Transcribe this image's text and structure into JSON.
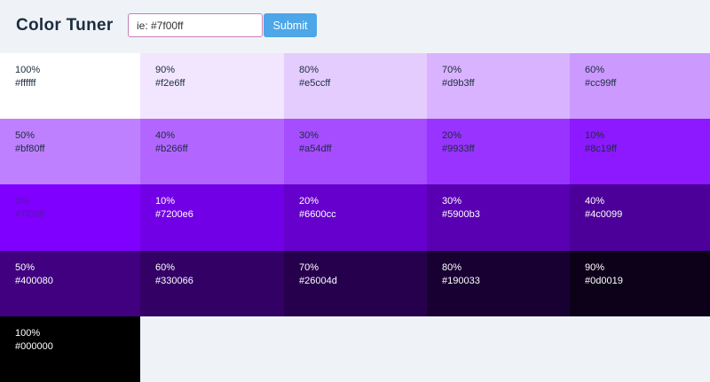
{
  "header": {
    "title": "Color Tuner",
    "input_placeholder": "ie: #7f00ff",
    "input_value": "",
    "submit_label": "Submit"
  },
  "swatches": [
    {
      "percent": "100%",
      "hex": "#ffffff",
      "bg": "#ffffff",
      "fg": "#1b2c3f"
    },
    {
      "percent": "90%",
      "hex": "#f2e6ff",
      "bg": "#f2e6ff",
      "fg": "#1b2c3f"
    },
    {
      "percent": "80%",
      "hex": "#e5ccff",
      "bg": "#e5ccff",
      "fg": "#1b2c3f"
    },
    {
      "percent": "70%",
      "hex": "#d9b3ff",
      "bg": "#d9b3ff",
      "fg": "#1b2c3f"
    },
    {
      "percent": "60%",
      "hex": "#cc99ff",
      "bg": "#cc99ff",
      "fg": "#1b2c3f"
    },
    {
      "percent": "50%",
      "hex": "#bf80ff",
      "bg": "#bf80ff",
      "fg": "#1b2c3f"
    },
    {
      "percent": "40%",
      "hex": "#b266ff",
      "bg": "#b266ff",
      "fg": "#1b2c3f"
    },
    {
      "percent": "30%",
      "hex": "#a54dff",
      "bg": "#a54dff",
      "fg": "#1b2c3f"
    },
    {
      "percent": "20%",
      "hex": "#9933ff",
      "bg": "#9933ff",
      "fg": "#1b2c3f"
    },
    {
      "percent": "10%",
      "hex": "#8c19ff",
      "bg": "#8c19ff",
      "fg": "#1b2c3f"
    },
    {
      "percent": "0%",
      "hex": "#7f00ff",
      "bg": "#7f00ff",
      "fg": "#5a14b0"
    },
    {
      "percent": "10%",
      "hex": "#7200e6",
      "bg": "#7200e6",
      "fg": "#ffffff"
    },
    {
      "percent": "20%",
      "hex": "#6600cc",
      "bg": "#6600cc",
      "fg": "#ffffff"
    },
    {
      "percent": "30%",
      "hex": "#5900b3",
      "bg": "#5900b3",
      "fg": "#ffffff"
    },
    {
      "percent": "40%",
      "hex": "#4c0099",
      "bg": "#4c0099",
      "fg": "#ffffff"
    },
    {
      "percent": "50%",
      "hex": "#400080",
      "bg": "#400080",
      "fg": "#ffffff"
    },
    {
      "percent": "60%",
      "hex": "#330066",
      "bg": "#330066",
      "fg": "#ffffff"
    },
    {
      "percent": "70%",
      "hex": "#26004d",
      "bg": "#26004d",
      "fg": "#ffffff"
    },
    {
      "percent": "80%",
      "hex": "#190033",
      "bg": "#190033",
      "fg": "#ffffff"
    },
    {
      "percent": "90%",
      "hex": "#0d0019",
      "bg": "#0d0019",
      "fg": "#ffffff"
    },
    {
      "percent": "100%",
      "hex": "#000000",
      "bg": "#000000",
      "fg": "#ffffff"
    }
  ],
  "colors": {
    "page_bg": "#eff3f8",
    "title": "#1b2c3f",
    "input_border": "#c77fb9",
    "submit_bg": "#4da6e8"
  }
}
